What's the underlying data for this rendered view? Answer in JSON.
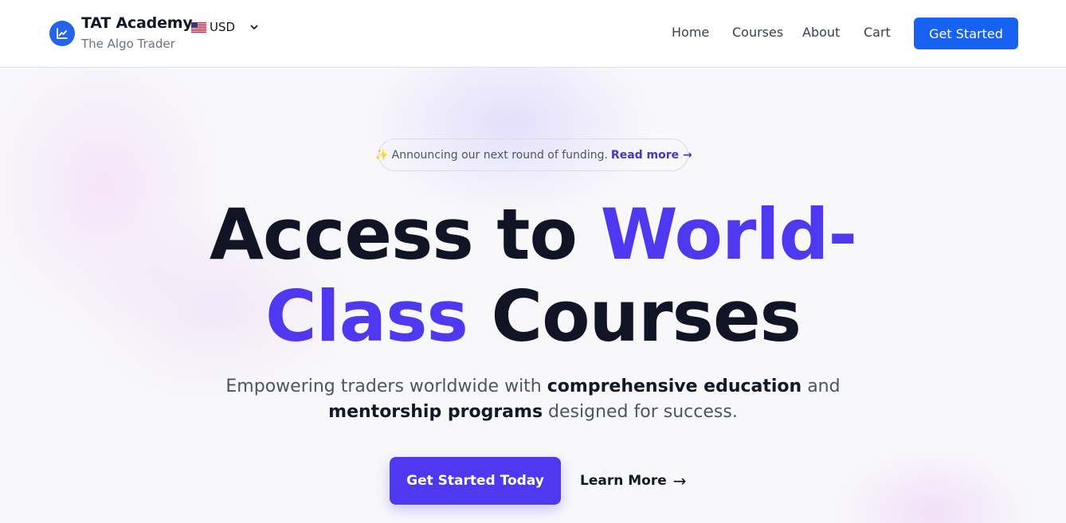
{
  "header": {
    "logo_icon": "trending-up-chart-icon",
    "brand_name": "TAT Academy",
    "brand_subtitle": "The Algo Trader",
    "currency": {
      "flag": "US flag",
      "label": "USD",
      "icon": "chevron-down-icon"
    },
    "nav": [
      {
        "label": "Home"
      },
      {
        "label": "Courses"
      },
      {
        "label": "About"
      },
      {
        "label": "Cart"
      }
    ],
    "cta_label": "Get Started"
  },
  "hero": {
    "announcement": {
      "icon": "✨",
      "text": "Announcing our next round of funding.",
      "link_label": "Read more",
      "link_arrow": "→"
    },
    "headline": {
      "part1": "Access to ",
      "accent1": "World-",
      "accent2": "Class",
      "part2": " Courses"
    },
    "subtitle": {
      "text1": "Empowering traders worldwide with ",
      "bold1": "comprehensive education",
      "text2": " and",
      "bold2": "mentorship programs",
      "text3": " designed for success."
    },
    "primary_cta": "Get Started Today",
    "secondary_cta": "Learn More",
    "secondary_arrow": "→"
  },
  "colors": {
    "header_button": "#1762f0",
    "accent": "#4f39f0",
    "link": "#4338ca",
    "text_dark": "#111425",
    "text_muted": "#4b5563"
  }
}
